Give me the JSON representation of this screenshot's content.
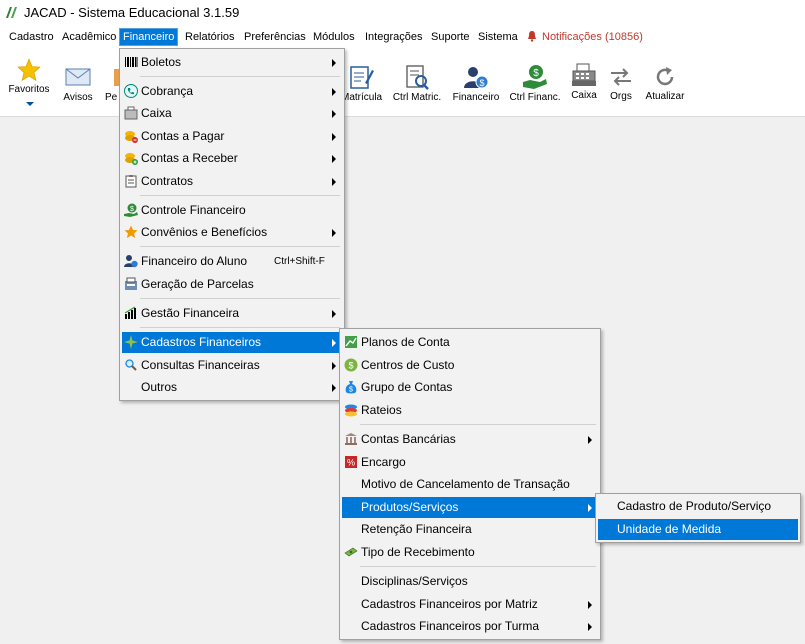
{
  "window": {
    "title": "JACAD - Sistema Educacional 3.1.59"
  },
  "menubar": {
    "items": [
      "Cadastro",
      "Acadêmico",
      "Financeiro",
      "Relatórios",
      "Preferências",
      "Módulos",
      "Integrações",
      "Suporte",
      "Sistema"
    ],
    "active": "Financeiro",
    "notifications": "Notificações (10856)"
  },
  "toolbar": {
    "favoritos": "Favoritos",
    "avisos": "Avisos",
    "pe": "Pe",
    "matricula": "Matrícula",
    "ctrl_matric": "Ctrl Matric.",
    "financeiro": "Financeiro",
    "ctrl_financ": "Ctrl Financ.",
    "caixa": "Caixa",
    "orgs": "Orgs",
    "atualizar": "Atualizar"
  },
  "financeiro_menu": {
    "boletos": "Boletos",
    "cobranca": "Cobrança",
    "caixa": "Caixa",
    "contas_pagar": "Contas a Pagar",
    "contas_receber": "Contas a Receber",
    "contratos": "Contratos",
    "controle_financeiro": "Controle Financeiro",
    "convenios": "Convênios e Benefícios",
    "financeiro_aluno": "Financeiro do Aluno",
    "financeiro_aluno_shortcut": "Ctrl+Shift-F",
    "geracao_parcelas": "Geração de Parcelas",
    "gestao_financeira": "Gestão Financeira",
    "cadastros_financeiros": "Cadastros Financeiros",
    "consultas_financeiras": "Consultas Financeiras",
    "outros": "Outros"
  },
  "cadastros_menu": {
    "planos_conta": "Planos de Conta",
    "centros_custo": "Centros de Custo",
    "grupo_contas": "Grupo de Contas",
    "rateios": "Rateios",
    "contas_bancarias": "Contas Bancárias",
    "encargo": "Encargo",
    "motivo_cancelamento": "Motivo de Cancelamento de Transação",
    "produtos_servicos": "Produtos/Serviços",
    "retencao_financeira": "Retenção Financeira",
    "tipo_recebimento": "Tipo de Recebimento",
    "disciplinas_servicos": "Disciplinas/Serviços",
    "cad_por_matriz": "Cadastros Financeiros por Matriz",
    "cad_por_turma": "Cadastros Financeiros por Turma"
  },
  "produtos_menu": {
    "cadastro_produto": "Cadastro de Produto/Serviço",
    "unidade_medida": "Unidade de Medida"
  },
  "colors": {
    "highlight": "#0078d7",
    "menu_bg": "#f2f2f2",
    "notification": "#c0392b"
  }
}
